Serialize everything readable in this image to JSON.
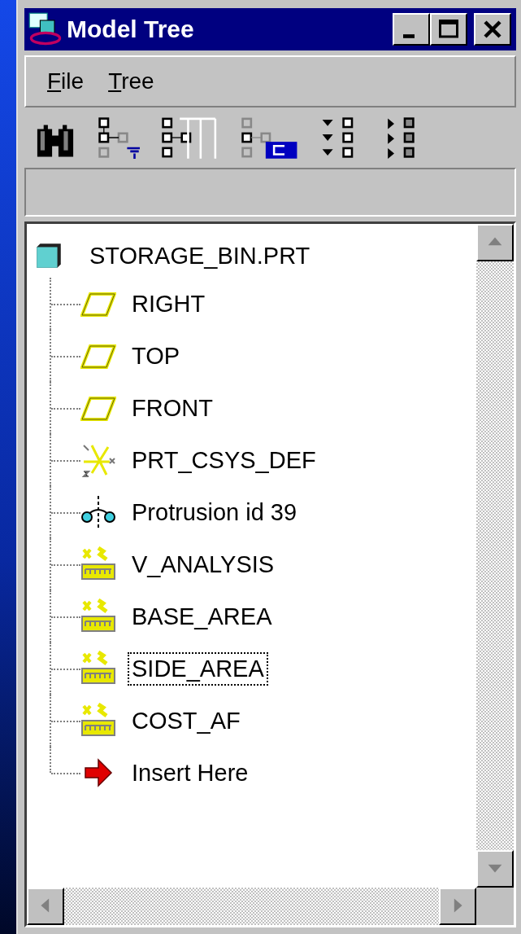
{
  "window": {
    "title": "Model Tree"
  },
  "menu": [
    {
      "label": "File"
    },
    {
      "label": "Tree"
    }
  ],
  "toolbar": [
    {
      "kind": "find"
    },
    {
      "kind": "filter"
    },
    {
      "kind": "columns"
    },
    {
      "kind": "select"
    },
    {
      "kind": "expand"
    },
    {
      "kind": "collapse"
    }
  ],
  "tree": {
    "label": "STORAGE_BIN.PRT",
    "kind": "part",
    "selected": false,
    "children": [
      {
        "label": "RIGHT",
        "kind": "datum_plane",
        "selected": false
      },
      {
        "label": "TOP",
        "kind": "datum_plane",
        "selected": false
      },
      {
        "label": "FRONT",
        "kind": "datum_plane",
        "selected": false
      },
      {
        "label": "PRT_CSYS_DEF",
        "kind": "csys",
        "selected": false
      },
      {
        "label": "Protrusion id 39",
        "kind": "protrusion",
        "selected": false
      },
      {
        "label": "V_ANALYSIS",
        "kind": "analysis",
        "selected": false
      },
      {
        "label": "BASE_AREA",
        "kind": "analysis",
        "selected": false
      },
      {
        "label": "SIDE_AREA",
        "kind": "analysis",
        "selected": true
      },
      {
        "label": "COST_AF",
        "kind": "analysis",
        "selected": false
      },
      {
        "label": "Insert Here",
        "kind": "insert",
        "selected": false
      }
    ]
  }
}
